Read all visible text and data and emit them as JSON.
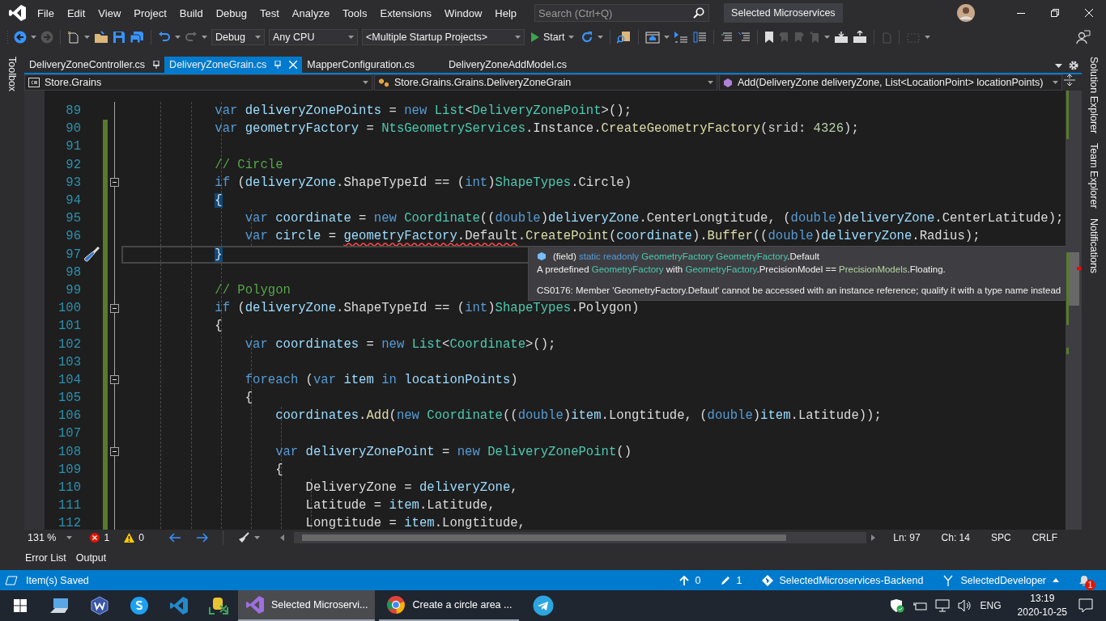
{
  "title_bar": {
    "menu": [
      "File",
      "Edit",
      "View",
      "Project",
      "Build",
      "Debug",
      "Test",
      "Analyze",
      "Tools",
      "Extensions",
      "Window",
      "Help"
    ],
    "search": {
      "placeholder": "Search (Ctrl+Q)"
    },
    "solution_name": "Selected Microservices"
  },
  "toolbar": {
    "configuration": "Debug",
    "platform": "Any CPU",
    "startup": "<Multiple Startup Projects>",
    "start": "Start"
  },
  "side_panels": {
    "left": [
      "Toolbox"
    ],
    "right": [
      "Solution Explorer",
      "Team Explorer",
      "Notifications"
    ]
  },
  "document_tabs": [
    {
      "label": "DeliveryZoneController.cs",
      "pinned": true,
      "selected": false
    },
    {
      "label": "DeliveryZoneGrain.cs",
      "pinned": true,
      "selected": true
    },
    {
      "label": "MapperConfiguration.cs",
      "pinned": false,
      "selected": false
    },
    {
      "label": "DeliveryZoneAddModel.cs",
      "pinned": false,
      "selected": false
    }
  ],
  "navigation_bar": {
    "project": "Store.Grains",
    "type": "Store.Grains.Grains.DeliveryZoneGrain",
    "member": "Add(DeliveryZone deliveryZone, List<LocationPoint> locationPoints)"
  },
  "editor": {
    "lines": [
      {
        "number": "89",
        "changed": false,
        "fold": false,
        "current": false,
        "tokens": [
          {
            "kind": "kw",
            "text": "            var"
          },
          {
            "kind": "loc",
            "text": " deliveryZonePoints"
          },
          {
            "kind": "p",
            "text": " = "
          },
          {
            "kind": "kw",
            "text": "new"
          },
          {
            "kind": "ty",
            "text": " List"
          },
          {
            "kind": "p",
            "text": "<"
          },
          {
            "kind": "ty",
            "text": "DeliveryZonePoint"
          },
          {
            "kind": "p",
            "text": ">();"
          }
        ]
      },
      {
        "number": "90",
        "changed": true,
        "fold": false,
        "current": false,
        "tokens": [
          {
            "kind": "kw",
            "text": "            var"
          },
          {
            "kind": "loc",
            "text": " geometryFactory"
          },
          {
            "kind": "p",
            "text": " = "
          },
          {
            "kind": "ty",
            "text": "NtsGeometryServices"
          },
          {
            "kind": "p",
            "text": ".Instance."
          },
          {
            "kind": "m",
            "text": "CreateGeometryFactory"
          },
          {
            "kind": "p",
            "text": "("
          },
          {
            "kind": "prm",
            "text": "srid"
          },
          {
            "kind": "p",
            "text": ": "
          },
          {
            "kind": "num",
            "text": "4326"
          },
          {
            "kind": "p",
            "text": ");"
          }
        ]
      },
      {
        "number": "91",
        "changed": true,
        "fold": false,
        "current": false
      },
      {
        "number": "92",
        "changed": true,
        "fold": false,
        "current": false,
        "tokens": [
          {
            "kind": "cm",
            "text": "            // Circle"
          }
        ]
      },
      {
        "number": "93",
        "changed": true,
        "fold": true,
        "current": false,
        "tokens": [
          {
            "kind": "kw",
            "text": "            if"
          },
          {
            "kind": "p",
            "text": " ("
          },
          {
            "kind": "loc",
            "text": "deliveryZone"
          },
          {
            "kind": "p",
            "text": ".ShapeTypeId == ("
          },
          {
            "kind": "kw",
            "text": "int"
          },
          {
            "kind": "p",
            "text": ")"
          },
          {
            "kind": "ty",
            "text": "ShapeTypes"
          },
          {
            "kind": "p",
            "text": ".Circle)"
          }
        ]
      },
      {
        "number": "94",
        "changed": true,
        "fold": false,
        "current": false,
        "tokens": [
          {
            "kind": "hl",
            "text": "            {"
          }
        ]
      },
      {
        "number": "95",
        "changed": true,
        "fold": false,
        "current": false,
        "tokens": [
          {
            "kind": "kw",
            "text": "                var"
          },
          {
            "kind": "loc",
            "text": " coordinate"
          },
          {
            "kind": "p",
            "text": " = "
          },
          {
            "kind": "kw",
            "text": "new"
          },
          {
            "kind": "ty",
            "text": " Coordinate"
          },
          {
            "kind": "p",
            "text": "(("
          },
          {
            "kind": "kw",
            "text": "double"
          },
          {
            "kind": "p",
            "text": ")"
          },
          {
            "kind": "loc",
            "text": "deliveryZone"
          },
          {
            "kind": "p",
            "text": ".CenterLongtitude, ("
          },
          {
            "kind": "kw",
            "text": "double"
          },
          {
            "kind": "p",
            "text": ")"
          },
          {
            "kind": "loc",
            "text": "deliveryZone"
          },
          {
            "kind": "p",
            "text": ".CenterLatitude);"
          }
        ]
      },
      {
        "number": "96",
        "changed": true,
        "fold": false,
        "current": false,
        "tokens": [
          {
            "kind": "kw",
            "text": "                var"
          },
          {
            "kind": "loc",
            "text": " circle"
          },
          {
            "kind": "p",
            "text": " = "
          },
          {
            "kind": "err-loc",
            "text": "geometryFactory"
          },
          {
            "kind": "err-p",
            "text": ".Default"
          },
          {
            "kind": "p",
            "text": "."
          },
          {
            "kind": "m",
            "text": "CreatePoint"
          },
          {
            "kind": "p",
            "text": "("
          },
          {
            "kind": "loc",
            "text": "coordinate"
          },
          {
            "kind": "p",
            "text": ")."
          },
          {
            "kind": "m",
            "text": "Buffer"
          },
          {
            "kind": "p",
            "text": "(("
          },
          {
            "kind": "kw",
            "text": "double"
          },
          {
            "kind": "p",
            "text": ")"
          },
          {
            "kind": "loc",
            "text": "deliveryZone"
          },
          {
            "kind": "p",
            "text": ".Radius);"
          }
        ]
      },
      {
        "number": "97",
        "changed": true,
        "fold": false,
        "current": true,
        "tokens": [
          {
            "kind": "hl",
            "text": "            }"
          }
        ]
      },
      {
        "number": "98",
        "changed": true,
        "fold": false,
        "current": false
      },
      {
        "number": "99",
        "changed": true,
        "fold": false,
        "current": false,
        "tokens": [
          {
            "kind": "cm",
            "text": "            // Polygon"
          }
        ]
      },
      {
        "number": "100",
        "changed": true,
        "fold": true,
        "current": false,
        "tokens": [
          {
            "kind": "kw",
            "text": "            if"
          },
          {
            "kind": "p",
            "text": " ("
          },
          {
            "kind": "loc",
            "text": "deliveryZone"
          },
          {
            "kind": "p",
            "text": ".ShapeTypeId == ("
          },
          {
            "kind": "kw",
            "text": "int"
          },
          {
            "kind": "p",
            "text": ")"
          },
          {
            "kind": "ty",
            "text": "ShapeTypes"
          },
          {
            "kind": "p",
            "text": ".Polygon)"
          }
        ]
      },
      {
        "number": "101",
        "changed": true,
        "fold": false,
        "current": false,
        "tokens": [
          {
            "kind": "p",
            "text": "            {"
          }
        ]
      },
      {
        "number": "102",
        "changed": true,
        "fold": false,
        "current": false,
        "tokens": [
          {
            "kind": "kw",
            "text": "                var"
          },
          {
            "kind": "loc",
            "text": " coordinates"
          },
          {
            "kind": "p",
            "text": " = "
          },
          {
            "kind": "kw",
            "text": "new"
          },
          {
            "kind": "ty",
            "text": " List"
          },
          {
            "kind": "p",
            "text": "<"
          },
          {
            "kind": "ty",
            "text": "Coordinate"
          },
          {
            "kind": "p",
            "text": ">();"
          }
        ]
      },
      {
        "number": "103",
        "changed": true,
        "fold": false,
        "current": false
      },
      {
        "number": "104",
        "changed": true,
        "fold": true,
        "current": false,
        "tokens": [
          {
            "kind": "kw",
            "text": "                foreach"
          },
          {
            "kind": "p",
            "text": " ("
          },
          {
            "kind": "kw",
            "text": "var"
          },
          {
            "kind": "loc",
            "text": " item"
          },
          {
            "kind": "kw",
            "text": " in"
          },
          {
            "kind": "loc",
            "text": " locationPoints"
          },
          {
            "kind": "p",
            "text": ")"
          }
        ]
      },
      {
        "number": "105",
        "changed": true,
        "fold": false,
        "current": false,
        "tokens": [
          {
            "kind": "p",
            "text": "                {"
          }
        ]
      },
      {
        "number": "106",
        "changed": true,
        "fold": false,
        "current": false,
        "tokens": [
          {
            "kind": "loc",
            "text": "                    coordinates"
          },
          {
            "kind": "p",
            "text": "."
          },
          {
            "kind": "m",
            "text": "Add"
          },
          {
            "kind": "p",
            "text": "("
          },
          {
            "kind": "kw",
            "text": "new"
          },
          {
            "kind": "ty",
            "text": " Coordinate"
          },
          {
            "kind": "p",
            "text": "(("
          },
          {
            "kind": "kw",
            "text": "double"
          },
          {
            "kind": "p",
            "text": ")"
          },
          {
            "kind": "loc",
            "text": "item"
          },
          {
            "kind": "p",
            "text": ".Longtitude, ("
          },
          {
            "kind": "kw",
            "text": "double"
          },
          {
            "kind": "p",
            "text": ")"
          },
          {
            "kind": "loc",
            "text": "item"
          },
          {
            "kind": "p",
            "text": ".Latitude));"
          }
        ]
      },
      {
        "number": "107",
        "changed": true,
        "fold": false,
        "current": false
      },
      {
        "number": "108",
        "changed": true,
        "fold": true,
        "current": false,
        "tokens": [
          {
            "kind": "kw",
            "text": "                    var"
          },
          {
            "kind": "loc",
            "text": " deliveryZonePoint"
          },
          {
            "kind": "p",
            "text": " = "
          },
          {
            "kind": "kw",
            "text": "new"
          },
          {
            "kind": "ty",
            "text": " DeliveryZonePoint"
          },
          {
            "kind": "p",
            "text": "()"
          }
        ]
      },
      {
        "number": "109",
        "changed": true,
        "fold": false,
        "current": false,
        "tokens": [
          {
            "kind": "p",
            "text": "                    {"
          }
        ]
      },
      {
        "number": "110",
        "changed": true,
        "fold": false,
        "current": false,
        "tokens": [
          {
            "kind": "p",
            "text": "                        DeliveryZone = "
          },
          {
            "kind": "loc",
            "text": "deliveryZone"
          },
          {
            "kind": "p",
            "text": ","
          }
        ]
      },
      {
        "number": "111",
        "changed": true,
        "fold": false,
        "current": false,
        "tokens": [
          {
            "kind": "p",
            "text": "                        Latitude = "
          },
          {
            "kind": "loc",
            "text": "item"
          },
          {
            "kind": "p",
            "text": ".Latitude,"
          }
        ]
      },
      {
        "number": "112",
        "changed": true,
        "fold": false,
        "current": false,
        "tokens": [
          {
            "kind": "p",
            "text": "                        Longtitude = "
          },
          {
            "kind": "loc",
            "text": "item"
          },
          {
            "kind": "p",
            "text": ".Longtitude,"
          }
        ]
      }
    ],
    "tooltip": {
      "lines": [
        [
          {
            "kind": "p",
            "text": "(field) "
          },
          {
            "kind": "kw",
            "text": "static readonly "
          },
          {
            "kind": "ty",
            "text": "GeometryFactory"
          },
          {
            "kind": "ty",
            "text": " GeometryFactory"
          },
          {
            "kind": "p",
            "text": ".Default"
          }
        ],
        [
          {
            "kind": "p",
            "text": "A predefined "
          },
          {
            "kind": "ty",
            "text": "GeometryFactory"
          },
          {
            "kind": "p",
            "text": " with "
          },
          {
            "kind": "ty",
            "text": "GeometryFactory"
          },
          {
            "kind": "p",
            "text": ".PrecisionModel == "
          },
          {
            "kind": "en",
            "text": "PrecisionModels"
          },
          {
            "kind": "p",
            "text": ".Floating."
          }
        ],
        [
          {
            "kind": "p",
            "text": "CS0176: Member 'GeometryFactory.Default' cannot be accessed with an instance reference; qualify it with a type name instead"
          }
        ]
      ]
    }
  },
  "editor_status": {
    "zoom": "131 %",
    "errors": "1",
    "warnings": "0",
    "line": "Ln: 97",
    "column": "Ch: 14",
    "whitespace": "SPC",
    "line_ending": "CRLF"
  },
  "tool_tabs": [
    "Error List",
    "Output"
  ],
  "status_bar": {
    "message": "Item(s) Saved",
    "pushes": "0",
    "changes": "1",
    "repository": "SelectedMicroservices-Backend",
    "branch": "SelectedDeveloper",
    "notifications": "1"
  },
  "taskbar": {
    "apps": [
      {
        "selected": false
      },
      {
        "selected": false
      },
      {
        "selected": false
      },
      {
        "selected": false
      },
      {
        "selected": false
      },
      {
        "label": "Selected Microservi...",
        "selected": true
      },
      {
        "label": "Create a circle area ...",
        "selected": false
      },
      {
        "selected": false
      }
    ],
    "language": "ENG",
    "time": "13:19",
    "date": "2020-10-25"
  }
}
